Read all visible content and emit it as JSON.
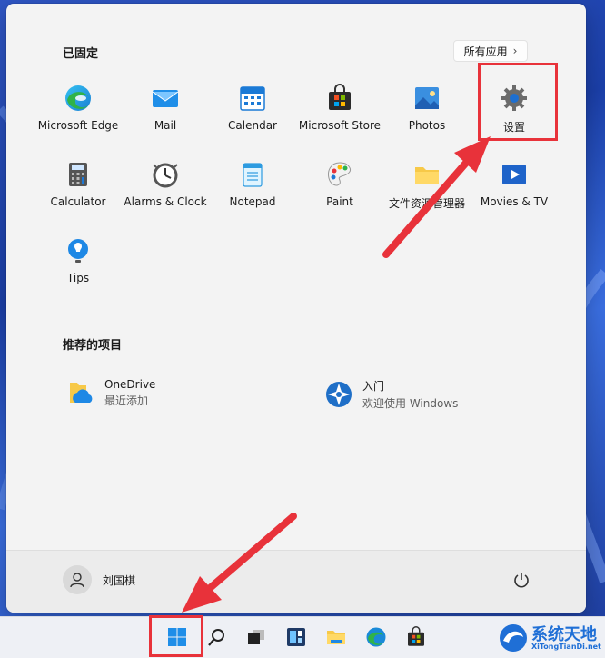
{
  "pinned": {
    "title": "已固定",
    "all_apps_label": "所有应用",
    "apps": [
      {
        "label": "Microsoft Edge",
        "icon": "edge-icon"
      },
      {
        "label": "Mail",
        "icon": "mail-icon"
      },
      {
        "label": "Calendar",
        "icon": "calendar-icon"
      },
      {
        "label": "Microsoft Store",
        "icon": "store-icon"
      },
      {
        "label": "Photos",
        "icon": "photos-icon"
      },
      {
        "label": "设置",
        "icon": "settings-gear-icon"
      },
      {
        "label": "Calculator",
        "icon": "calculator-icon"
      },
      {
        "label": "Alarms & Clock",
        "icon": "clock-icon"
      },
      {
        "label": "Notepad",
        "icon": "notepad-icon"
      },
      {
        "label": "Paint",
        "icon": "paint-icon"
      },
      {
        "label": "文件资源管理器",
        "icon": "folder-icon"
      },
      {
        "label": "Movies & TV",
        "icon": "movies-icon"
      },
      {
        "label": "Tips",
        "icon": "tips-icon"
      }
    ]
  },
  "recommended": {
    "title": "推荐的项目",
    "items": [
      {
        "title": "OneDrive",
        "subtitle": "最近添加",
        "icon": "onedrive-icon"
      },
      {
        "title": "入门",
        "subtitle": "欢迎使用 Windows",
        "icon": "get-started-icon"
      }
    ]
  },
  "user": {
    "name": "刘国棋"
  },
  "taskbar": {
    "icons": [
      "start-icon",
      "search-icon",
      "task-view-icon",
      "widgets-icon",
      "file-explorer-icon",
      "edge-icon",
      "store-icon"
    ]
  },
  "watermark": {
    "text": "系统天地",
    "sub": "XiTongTianDi.net"
  },
  "colors": {
    "highlight": "#e8323a",
    "accent": "#0067c0"
  }
}
